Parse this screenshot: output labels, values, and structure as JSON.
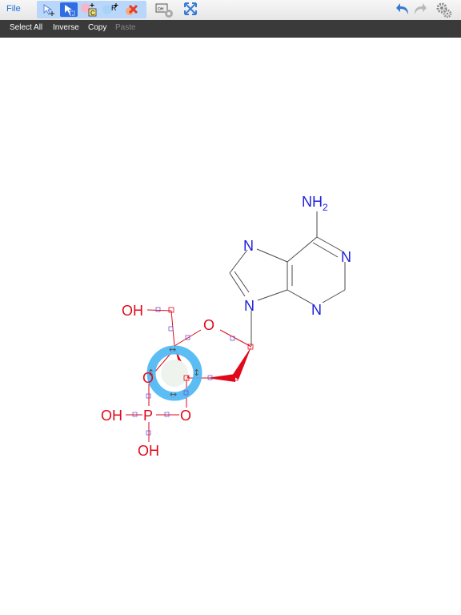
{
  "toolbar": {
    "file_label": "File",
    "tools": [
      "select-move-tool",
      "lasso-select-tool",
      "carbon-atom-tool",
      "r-group-tool",
      "delete-tool"
    ],
    "right_tools": [
      "window-icon",
      "fullscreen-icon",
      "undo-icon",
      "redo-icon",
      "settings-icon"
    ]
  },
  "edit_menu": {
    "select_all": "Select All",
    "inverse": "Inverse",
    "copy": "Copy",
    "paste": "Paste"
  },
  "molecule": {
    "atoms": {
      "nh2": "NH",
      "nh2_sub": "2",
      "n1": "N",
      "n3": "N",
      "n7": "N",
      "n9": "N",
      "o_ring": "O",
      "oh_top": "OH",
      "o_left": "O",
      "p": "P",
      "oh_p_left": "OH",
      "o_p_right": "O",
      "oh_p_bottom": "OH"
    },
    "colors": {
      "nitrogen": "#1e22d8",
      "oxygen": "#e0091a",
      "bond": "#4a4a4a",
      "selection_ring": "#52b9f2"
    }
  }
}
